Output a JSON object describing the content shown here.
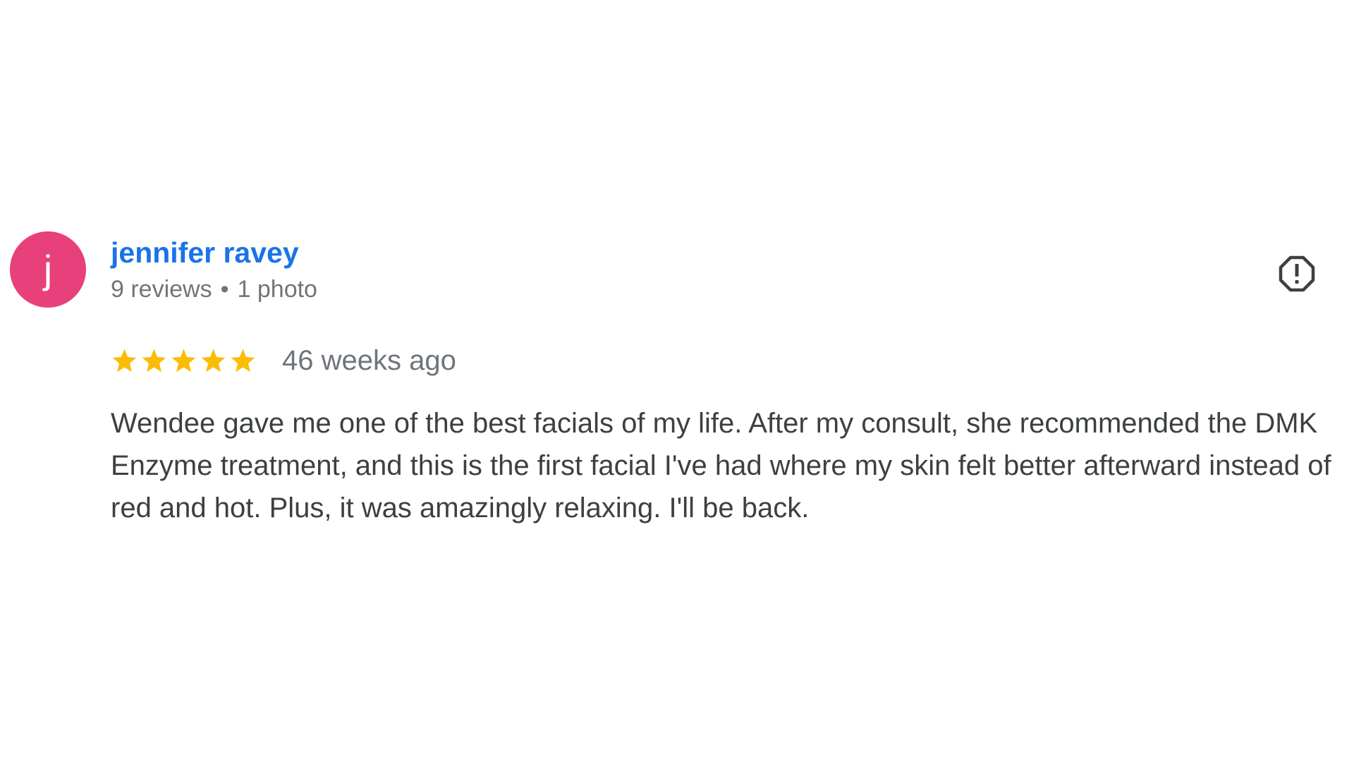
{
  "colors": {
    "avatar_bg": "#E8407A",
    "name_link": "#1A73E8",
    "meta_text": "#70757A",
    "body_text": "#3C4043",
    "star": "#FBBC04",
    "icon": "#3C4043"
  },
  "reviewer": {
    "avatar_letter": "j",
    "name": "jennifer ravey",
    "reviews_count": "9 reviews",
    "separator": "•",
    "photos_count": "1 photo"
  },
  "report_button": {
    "icon": "report-flag-octagon-icon"
  },
  "rating": {
    "stars": 5,
    "max": 5,
    "time_ago": "46 weeks ago"
  },
  "review": {
    "text": "Wendee gave me one of the best facials of my life. After my consult, she recommended the DMK Enzyme treatment, and this is the first facial I've had where my skin felt better afterward instead of red and hot. Plus, it was amazingly relaxing. I'll be back."
  }
}
